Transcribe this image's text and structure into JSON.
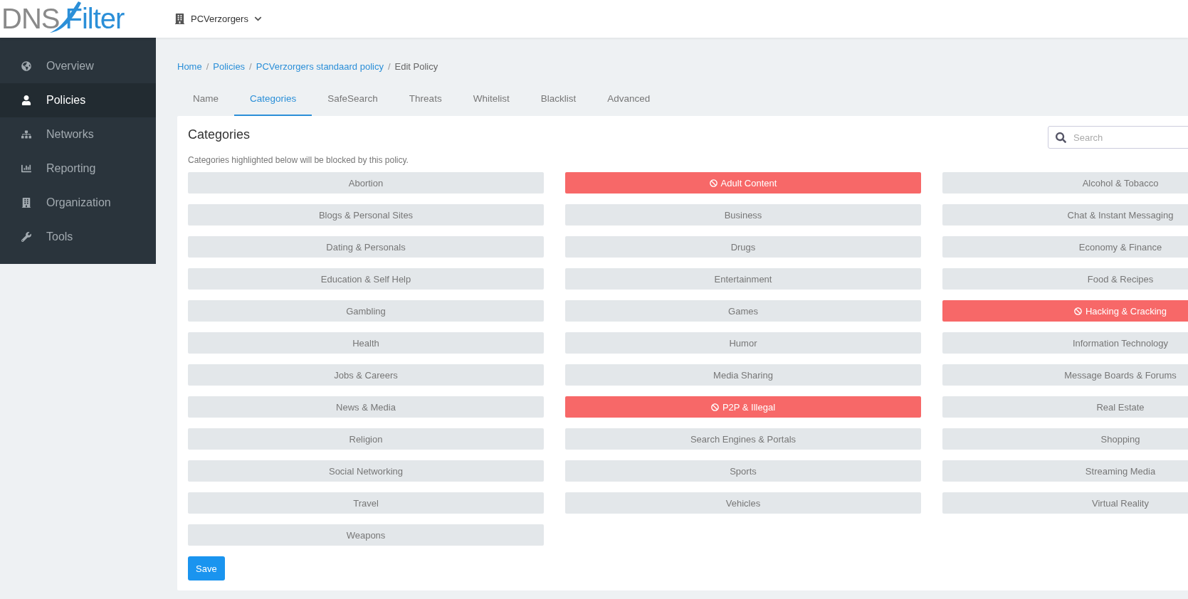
{
  "header": {
    "logo": {
      "part_1": "DNS",
      "part_2": "Filter"
    },
    "organization": "PCVerzorgers"
  },
  "sidebar": {
    "items": [
      {
        "label": "Overview",
        "selected": false
      },
      {
        "label": "Policies",
        "selected": true
      },
      {
        "label": "Networks",
        "selected": false
      },
      {
        "label": "Reporting",
        "selected": false
      },
      {
        "label": "Organization",
        "selected": false
      },
      {
        "label": "Tools",
        "selected": false
      }
    ]
  },
  "breadcrumb": {
    "links": [
      {
        "label": "Home",
        "separator": "/"
      },
      {
        "label": "Policies",
        "separator": "/"
      },
      {
        "label": "PCVerzorgers standaard policy",
        "separator": "/"
      }
    ],
    "current": "Edit Policy"
  },
  "tabs": [
    {
      "label": "Name",
      "selected": false
    },
    {
      "label": "Categories",
      "selected": true
    },
    {
      "label": "SafeSearch",
      "selected": false
    },
    {
      "label": "Threats",
      "selected": false
    },
    {
      "label": "Whitelist",
      "selected": false
    },
    {
      "label": "Blacklist",
      "selected": false
    },
    {
      "label": "Advanced",
      "selected": false
    }
  ],
  "card": {
    "title": "Categories",
    "search": {
      "placeholder": "Search"
    },
    "description": "Categories highlighted below will be blocked by this policy.",
    "categories": [
      {
        "label": "Abortion",
        "blocked": false
      },
      {
        "label": "Adult Content",
        "blocked": true
      },
      {
        "label": "Alcohol & Tobacco",
        "blocked": false
      },
      {
        "label": "Blogs & Personal Sites",
        "blocked": false
      },
      {
        "label": "Business",
        "blocked": false
      },
      {
        "label": "Chat & Instant Messaging",
        "blocked": false
      },
      {
        "label": "Dating & Personals",
        "blocked": false
      },
      {
        "label": "Drugs",
        "blocked": false
      },
      {
        "label": "Economy & Finance",
        "blocked": false
      },
      {
        "label": "Education & Self Help",
        "blocked": false
      },
      {
        "label": "Entertainment",
        "blocked": false
      },
      {
        "label": "Food & Recipes",
        "blocked": false
      },
      {
        "label": "Gambling",
        "blocked": false
      },
      {
        "label": "Games",
        "blocked": false
      },
      {
        "label": "Hacking & Cracking",
        "blocked": true
      },
      {
        "label": "Health",
        "blocked": false
      },
      {
        "label": "Humor",
        "blocked": false
      },
      {
        "label": "Information Technology",
        "blocked": false
      },
      {
        "label": "Jobs & Careers",
        "blocked": false
      },
      {
        "label": "Media Sharing",
        "blocked": false
      },
      {
        "label": "Message Boards & Forums",
        "blocked": false
      },
      {
        "label": "News & Media",
        "blocked": false
      },
      {
        "label": "P2P & Illegal",
        "blocked": true
      },
      {
        "label": "Real Estate",
        "blocked": false
      },
      {
        "label": "Religion",
        "blocked": false
      },
      {
        "label": "Search Engines & Portals",
        "blocked": false
      },
      {
        "label": "Shopping",
        "blocked": false
      },
      {
        "label": "Social Networking",
        "blocked": false
      },
      {
        "label": "Sports",
        "blocked": false
      },
      {
        "label": "Streaming Media",
        "blocked": false
      },
      {
        "label": "Travel",
        "blocked": false
      },
      {
        "label": "Vehicles",
        "blocked": false
      },
      {
        "label": "Virtual Reality",
        "blocked": false
      },
      {
        "label": "Weapons",
        "blocked": false
      }
    ],
    "save_button": "Save"
  }
}
